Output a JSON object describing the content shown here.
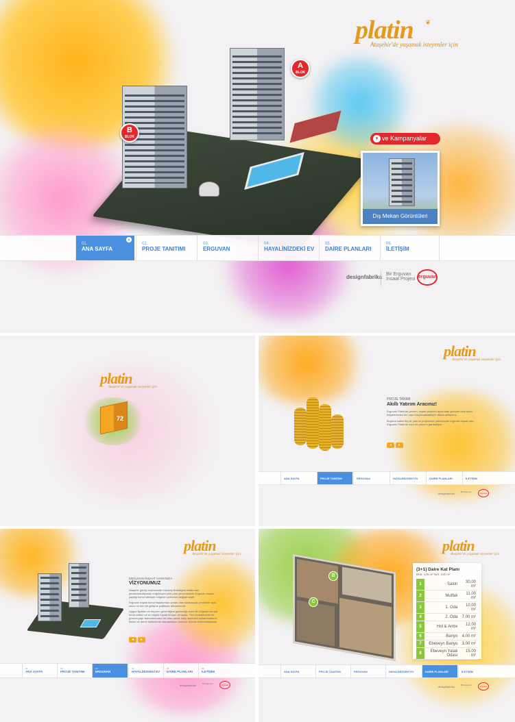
{
  "brand": {
    "name": "platin",
    "tagline": "Ataşehir'de yaşamak isteyenler için"
  },
  "hero": {
    "block_a": {
      "letter": "A",
      "label": "BLOK"
    },
    "block_b": {
      "letter": "B",
      "label": "BLOK"
    },
    "campaign_button": "ve Kampanyalar",
    "exterior_button": "Dış Mekan Görüntüleri"
  },
  "nav": [
    {
      "num": "01.",
      "label": "ANA SAYFA"
    },
    {
      "num": "02.",
      "label": "PROJE TANITIMI"
    },
    {
      "num": "03.",
      "label": "ERGUVAN"
    },
    {
      "num": "04.",
      "label": "HAYALİNİZDEKİ EV"
    },
    {
      "num": "05.",
      "label": "DAİRE PLANLARI"
    },
    {
      "num": "06.",
      "label": "İLETİŞİM"
    }
  ],
  "nav_small_2": [
    "ANA SAYFA",
    "PROJE TANITIMI",
    "ERGUVAN",
    "HAYALİNİZDEKİ EV",
    "DAİRE PLANLARI",
    "İLETİŞİM"
  ],
  "footer": {
    "agency": "designfabrika",
    "project_line1": "Bir Erguvan",
    "project_line2": "İnsaat Projesi",
    "developer_logo": "erguvan"
  },
  "loader": {
    "progress_text": "72"
  },
  "proje": {
    "kicker": "PROJE TANIMI",
    "title": "Akıllı Yatırım Aracınız!",
    "p1": "Erguvan Platin'de yatırım, inşaat projeleri açısından gelecek vaat eden bölgelerinden biri olan Küçükbakkalköy'e dikkat çekiyoruz.",
    "p2": "Bugüne kadar hiç bir yatırım projesinde yanılmayan erguvan inşaat size Erguvan Platin ile karlı bir yatırımı garantiliyor..."
  },
  "erguvan": {
    "kicker": "ERGUVAN İNŞAAT HAKKINDA",
    "title": "VİZYONUMUZ",
    "p1": "Ataşehir güney cephesinde Kadıköy Belediyesi tarafından gecekondulaşmayı engelleyen yeni plan çerçevesinde Erguvan İnşaat yaptığı konut sitesiyle bölgenin çehresini değiştirmiştir.",
    "p2": "Erguvan İnşaat konut inşaasında uzman olan kadrosuyla yenilikere açık, cesur ve ileri bir gelişme politikası izlemektedir.",
    "p3": "Uygun fiyatları ve deprem güvenliğine gösterdiği özen ile bölgenin en çok tercih edilen ve en büyük inşaat firması olmuştur. Tüm konutlarında en güvenli yapı sistemlerinden biri olan perde kalıp sistemini kullanmaktadır. Beton ve demir kalitesinde standartların üstünde ürünler kullanılmaktadır."
  },
  "plan": {
    "title": "(3+1) Daire Kat Planı",
    "area": "Brüt: 125 m² Net: 100 m²",
    "rooms": [
      {
        "n": "1",
        "name": "Salon",
        "size": "30.00 m²"
      },
      {
        "n": "2",
        "name": "Mutfak",
        "size": "11.00 m²"
      },
      {
        "n": "3",
        "name": "1. Oda",
        "size": "10.00 m²"
      },
      {
        "n": "4",
        "name": "2. Oda",
        "size": "7.00 m²"
      },
      {
        "n": "5",
        "name": "Hol & Antre",
        "size": "12.00 m²"
      },
      {
        "n": "6",
        "name": "Banyo",
        "size": "4.00 m²"
      },
      {
        "n": "7",
        "name": "Ebeveyn Banyo",
        "size": "3.00 m²"
      },
      {
        "n": "8",
        "name": "Ebeveyn Yatak Odası",
        "size": "15.00 m²"
      }
    ],
    "marker_b": "B",
    "marker_c": "C"
  },
  "colors": {
    "accent": "#4a8fe0",
    "brand_orange": "#e69a1a",
    "badge_red": "#e2282b",
    "plan_green": "#8cc63f"
  }
}
